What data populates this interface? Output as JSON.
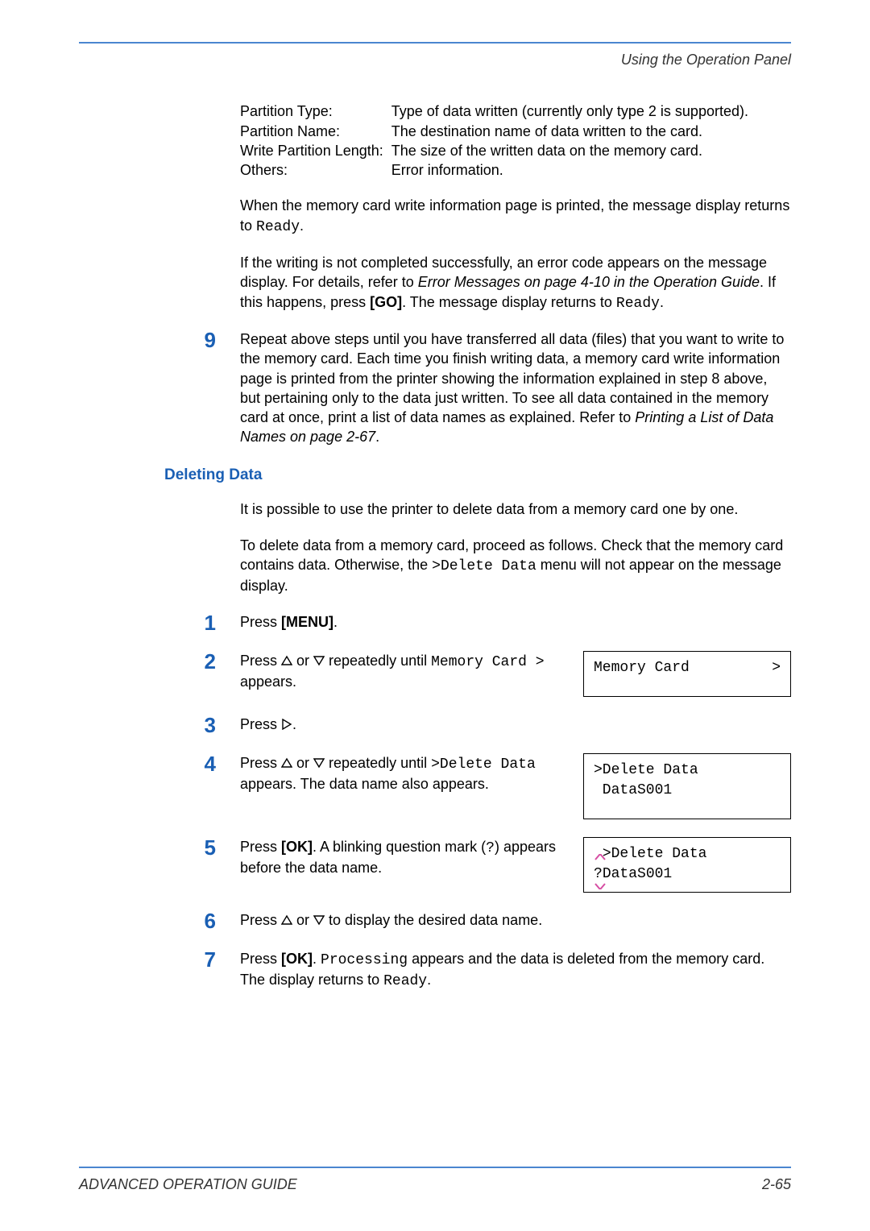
{
  "header": {
    "running_title": "Using the Operation Panel"
  },
  "defs": {
    "partition_type_key": "Partition Type:",
    "partition_type_val": "Type of data written (currently only type 2 is supported).",
    "partition_name_key": "Partition Name:",
    "partition_name_val": "The destination name of data written to the card.",
    "write_len_key": "Write Partition Length:",
    "write_len_val": "The size of the written data on the memory card.",
    "others_key": "Others:",
    "others_val": "Error information."
  },
  "paras": {
    "p1a": "When the memory card write information page is printed, the message display returns to ",
    "p1b": "Ready",
    "p1c": ".",
    "p2a": "If the writing is not completed successfully, an error code appears on the message display. For details, refer to ",
    "p2b": "Error Messages on page 4-10 in the Operation Guide",
    "p2c": ". If this happens, press ",
    "p2d": "[GO]",
    "p2e": ". The message display returns to ",
    "p2f": "Ready",
    "p2g": "."
  },
  "step9": {
    "num": "9",
    "a": "Repeat above steps until you have transferred all data (files) that you want to write to the memory card. Each time you finish writing data, a memory card write information page is printed from the printer showing the information explained in step 8 above, but pertaining only to the data just written. To see all data contained in the memory card at once, print a list of data names as explained. Refer to ",
    "b": "Printing a List of Data Names on page 2-67",
    "c": "."
  },
  "deleting": {
    "title": "Deleting Data",
    "intro1": "It is possible to use the printer to delete data from a memory card one by one.",
    "intro2a": "To delete data from a memory card, proceed as follows. Check that the memory card contains data. Otherwise, the ",
    "intro2b": ">Delete Data",
    "intro2c": " menu will not appear on the message display."
  },
  "steps": {
    "s1": {
      "num": "1",
      "a": "Press ",
      "b": "[MENU]",
      "c": "."
    },
    "s2": {
      "num": "2",
      "a": "Press ",
      "b": " or ",
      "c": " repeatedly until ",
      "d": "Memory Card >",
      "e": " appears.",
      "lcd_left": "Memory Card",
      "lcd_right": ">"
    },
    "s3": {
      "num": "3",
      "a": "Press ",
      "b": "."
    },
    "s4": {
      "num": "4",
      "a": "Press ",
      "b": " or ",
      "c": " repeatedly until ",
      "d": ">Delete Data ",
      "e": " appears. The data name also appears.",
      "lcd_line1": ">Delete Data",
      "lcd_line2": " DataS001"
    },
    "s5": {
      "num": "5",
      "a": "Press ",
      "b": "[OK]",
      "c": ". A blinking question mark (",
      "d": "?",
      "e": ") appears before the data name.",
      "lcd_line1": ">Delete Data",
      "lcd_line2_q": "?",
      "lcd_line2_rest": "DataS001"
    },
    "s6": {
      "num": "6",
      "a": "Press ",
      "b": " or ",
      "c": " to display the desired data name."
    },
    "s7": {
      "num": "7",
      "a": "Press ",
      "b": "[OK]",
      "c": ". ",
      "d": "Processing",
      "e": " appears and the data is deleted from the memory card. The display returns to ",
      "f": "Ready",
      "g": "."
    }
  },
  "footer": {
    "left": "ADVANCED OPERATION GUIDE",
    "right": "2-65"
  }
}
